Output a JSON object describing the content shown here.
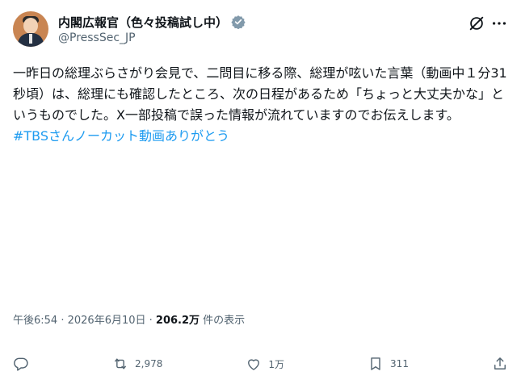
{
  "author": {
    "display_name": "内閣広報官（色々投稿試し中）",
    "handle": "@PressSec_JP"
  },
  "post": {
    "text": "一昨日の総理ぶらさがり会見で、二問目に移る際、総理が呟いた言葉（動画中１分31秒頃）は、総理にも確認したところ、次の日程があるため「ちょっと大丈夫かな」というものでした。X一部投稿で誤った情報が流れていますのでお伝えします。",
    "hashtag": "#TBSさんノーカット動画ありがとう"
  },
  "meta": {
    "time": "午後6:54",
    "separator1": " · ",
    "date": "2026年6月10日",
    "separator2": " · ",
    "views_count": "206.2万",
    "views_label": " 件の表示"
  },
  "actions": {
    "reply_icon": "reply-icon",
    "repost_count": "2,978",
    "like_count": "1万",
    "bookmark_count": "311",
    "share_icon": "share-icon"
  },
  "colors": {
    "link": "#1d9bf0",
    "secondary_text": "#536471",
    "verified": "#829aab"
  }
}
